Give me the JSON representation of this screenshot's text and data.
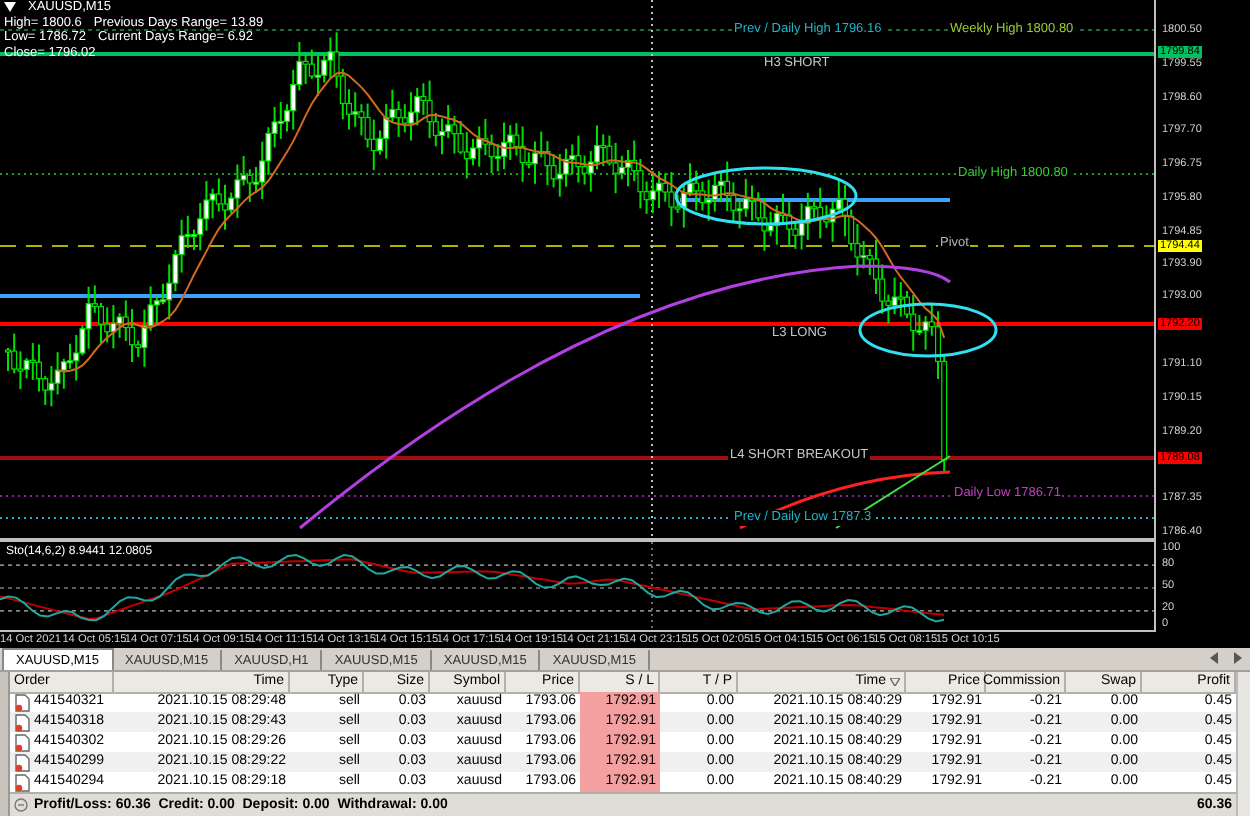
{
  "chart": {
    "symbol": "XAUUSD,M15",
    "info": [
      {
        "kind": "pair",
        "left": "High= 1800.6",
        "right": "Previous Days Range= 13.89"
      },
      {
        "kind": "pair",
        "left": "Low= 1786.72",
        "right": "Current Days Range= 6.92"
      },
      {
        "kind": "single",
        "left": "Close= 1796.02"
      }
    ],
    "labels": [
      {
        "text": "Prev / Daily High 1796.16",
        "color": "#1fb5c9"
      },
      {
        "text": "Weekly High 1800.80",
        "color": "#9acd32"
      },
      {
        "text": "H3 SHORT",
        "color": "#c8c8c8"
      },
      {
        "text": "Daily High 1800.80",
        "color": "#32cd32"
      },
      {
        "text": "Pivot",
        "color": "#b4b4b4"
      },
      {
        "text": "L3 LONG",
        "color": "#c8c8c8"
      },
      {
        "text": "L4 SHORT BREAKOUT",
        "color": "#c8c8c8"
      },
      {
        "text": "Daily Low 1786.71",
        "color": "#c040c0"
      },
      {
        "text": "Prev / Daily Low 1787.3",
        "color": "#1fb5c9"
      }
    ],
    "price_ticks": [
      "1800.50",
      "1799.55",
      "1798.60",
      "1797.70",
      "1796.75",
      "1795.80",
      "1794.85",
      "1793.90",
      "1793.00",
      "1791.10",
      "1790.15",
      "1789.20",
      "1787.35",
      "1786.40"
    ],
    "price_tags": [
      {
        "text": "1799.84",
        "color": "#00c060"
      },
      {
        "text": "1794.44",
        "color": "#ffff00"
      },
      {
        "text": "1792.20",
        "color": "#ff0000"
      },
      {
        "text": "1789.08",
        "color": "#ff0000"
      }
    ],
    "indicator": {
      "label": "Sto(14,6,2) 8.9441 12.0805",
      "ticks": [
        "100",
        "80",
        "50",
        "20",
        "0"
      ]
    },
    "time_ticks": [
      "14 Oct 2021",
      "14 Oct 05:15",
      "14 Oct 07:15",
      "14 Oct 09:15",
      "14 Oct 11:15",
      "14 Oct 13:15",
      "14 Oct 15:15",
      "14 Oct 17:15",
      "14 Oct 19:15",
      "14 Oct 21:15",
      "14 Oct 23:15",
      "15 Oct 02:05",
      "15 Oct 04:15",
      "15 Oct 06:15",
      "15 Oct 08:15",
      "15 Oct 10:15"
    ]
  },
  "tabs": [
    {
      "label": "XAUUSD,M15",
      "selected": true
    },
    {
      "label": "XAUUSD,M15",
      "selected": false
    },
    {
      "label": "XAUUSD,H1",
      "selected": false
    },
    {
      "label": "XAUUSD,M15",
      "selected": false
    },
    {
      "label": "XAUUSD,M15",
      "selected": false
    },
    {
      "label": "XAUUSD,M15",
      "selected": false
    }
  ],
  "table": {
    "columns": [
      {
        "label": "Order",
        "sorted": false
      },
      {
        "label": "Time",
        "sorted": false
      },
      {
        "label": "Type",
        "sorted": false
      },
      {
        "label": "Size",
        "sorted": false
      },
      {
        "label": "Symbol",
        "sorted": false
      },
      {
        "label": "Price",
        "sorted": false
      },
      {
        "label": "S / L",
        "sorted": false
      },
      {
        "label": "T / P",
        "sorted": false
      },
      {
        "label": "Time",
        "sorted": true
      },
      {
        "label": "Price",
        "sorted": false
      },
      {
        "label": "Commission",
        "sorted": false
      },
      {
        "label": "Swap",
        "sorted": false
      },
      {
        "label": "Profit",
        "sorted": false
      }
    ],
    "rows": [
      [
        "441540321",
        "2021.10.15 08:29:48",
        "sell",
        "0.03",
        "xauusd",
        "1793.06",
        "1792.91",
        "0.00",
        "2021.10.15 08:40:29",
        "1792.91",
        "-0.21",
        "0.00",
        "0.45"
      ],
      [
        "441540318",
        "2021.10.15 08:29:43",
        "sell",
        "0.03",
        "xauusd",
        "1793.06",
        "1792.91",
        "0.00",
        "2021.10.15 08:40:29",
        "1792.91",
        "-0.21",
        "0.00",
        "0.45"
      ],
      [
        "441540302",
        "2021.10.15 08:29:26",
        "sell",
        "0.03",
        "xauusd",
        "1793.06",
        "1792.91",
        "0.00",
        "2021.10.15 08:40:29",
        "1792.91",
        "-0.21",
        "0.00",
        "0.45"
      ],
      [
        "441540299",
        "2021.10.15 08:29:22",
        "sell",
        "0.03",
        "xauusd",
        "1793.06",
        "1792.91",
        "0.00",
        "2021.10.15 08:40:29",
        "1792.91",
        "-0.21",
        "0.00",
        "0.45"
      ],
      [
        "441540294",
        "2021.10.15 08:29:18",
        "sell",
        "0.03",
        "xauusd",
        "1793.06",
        "1792.91",
        "0.00",
        "2021.10.15 08:40:29",
        "1792.91",
        "-0.21",
        "0.00",
        "0.45"
      ]
    ],
    "footer": {
      "summary": "Profit/Loss: 60.36  Credit: 0.00  Deposit: 0.00  Withdrawal: 0.00",
      "total": "60.36"
    }
  }
}
